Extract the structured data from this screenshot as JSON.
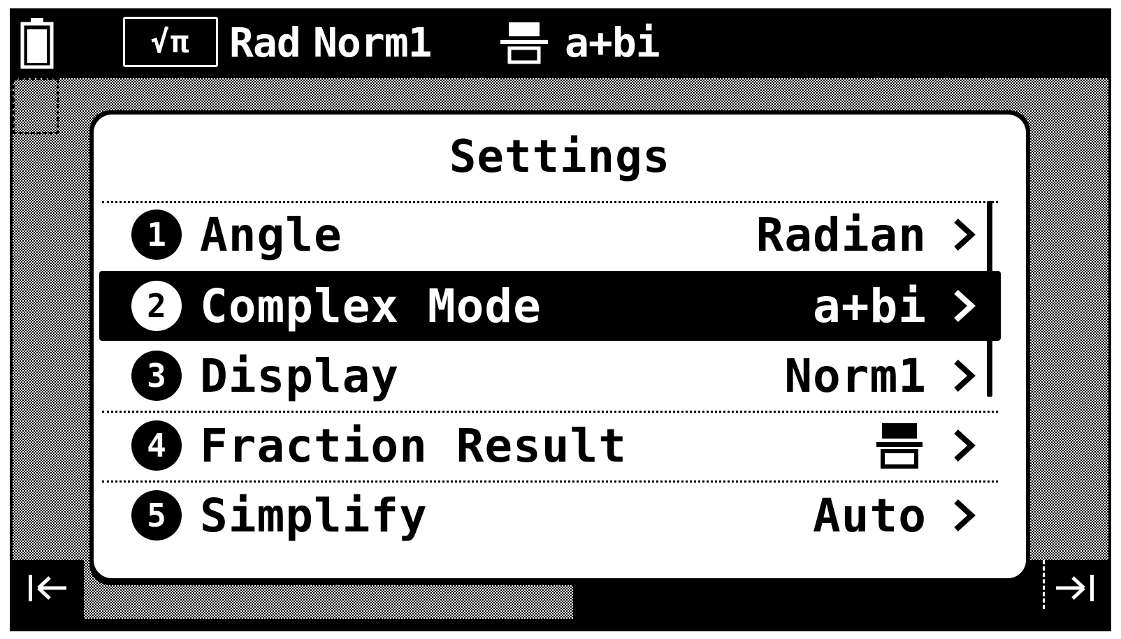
{
  "status_bar": {
    "battery_icon": "battery-icon",
    "input_mode": "√π",
    "angle": "Rad",
    "display": "Norm1",
    "fraction_icon": "fraction-result-icon",
    "complex": "a+bi"
  },
  "dialog": {
    "title": "Settings",
    "items": [
      {
        "number": "1",
        "label": "Angle",
        "value": "Radian",
        "selected": false
      },
      {
        "number": "2",
        "label": "Complex Mode",
        "value": "a+bi",
        "selected": true
      },
      {
        "number": "3",
        "label": "Display",
        "value": "Norm1",
        "selected": false
      },
      {
        "number": "4",
        "label": "Fraction Result",
        "value": "",
        "value_icon": "fraction-result-icon",
        "selected": false
      },
      {
        "number": "5",
        "label": "Simplify",
        "value": "Auto",
        "selected": false
      }
    ]
  },
  "bottom_bar": {
    "left_icon": "back-to-start-icon",
    "right_icon": "forward-to-end-icon"
  }
}
